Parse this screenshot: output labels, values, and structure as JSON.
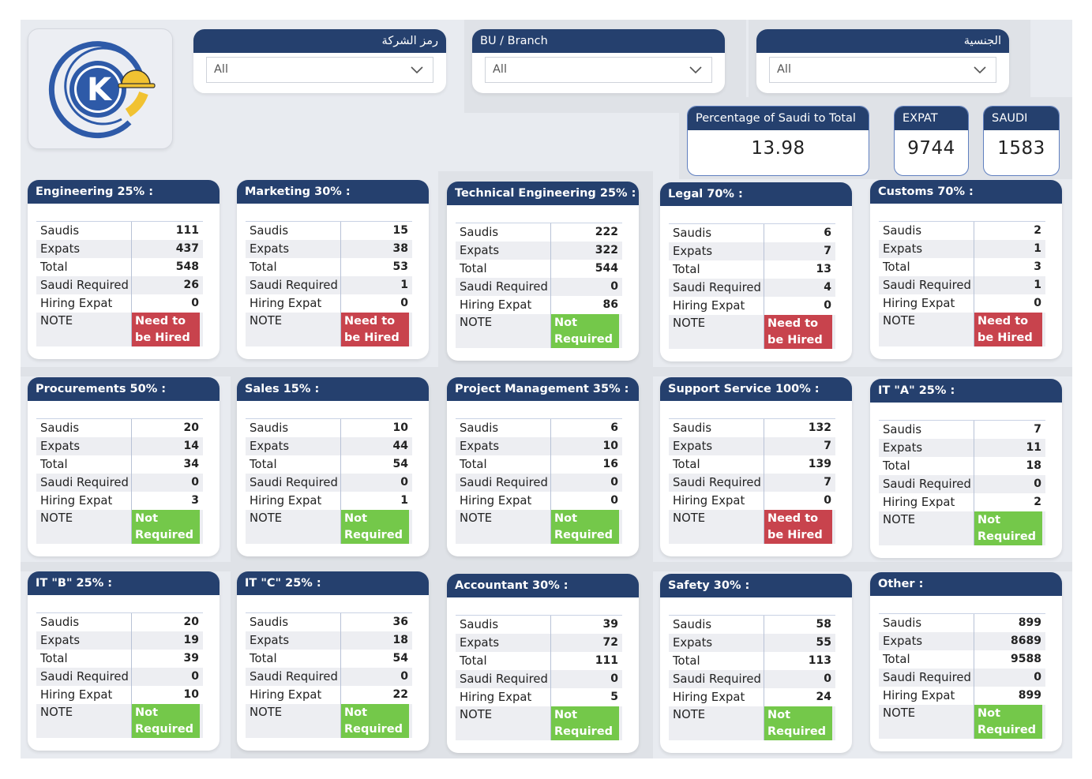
{
  "colors": {
    "header": "#25406e",
    "need_badge": "#c8434d",
    "not_badge": "#74c84a"
  },
  "logo": {
    "letter": "K"
  },
  "filters": [
    {
      "label": "رمز الشركة",
      "value": "All"
    },
    {
      "label": "BU / Branch",
      "value": "All"
    },
    {
      "label": "الجنسية",
      "value": "All"
    }
  ],
  "kpis": [
    {
      "label": "Percentage of Saudi to Total",
      "value": "13.98"
    },
    {
      "label": "EXPAT",
      "value": "9744"
    },
    {
      "label": "SAUDI",
      "value": "1583"
    }
  ],
  "row_labels": [
    "Saudis",
    "Expats",
    "Total",
    "Saudi Required",
    "Hiring Expat",
    "NOTE"
  ],
  "badges": {
    "need": [
      "Need to",
      "be Hired"
    ],
    "not": [
      "Not",
      "Required"
    ]
  },
  "departments": [
    {
      "title": "Engineering 25% :",
      "values": [
        "111",
        "437",
        "548",
        "26",
        "0"
      ],
      "status": "need"
    },
    {
      "title": "Marketing 30% :",
      "values": [
        "15",
        "38",
        "53",
        "1",
        "0"
      ],
      "status": "need"
    },
    {
      "title": "Technical Engineering 25% :",
      "values": [
        "222",
        "322",
        "544",
        "0",
        "86"
      ],
      "status": "not"
    },
    {
      "title": "Legal 70% :",
      "values": [
        "6",
        "7",
        "13",
        "4",
        "0"
      ],
      "status": "need"
    },
    {
      "title": "Customs 70% :",
      "values": [
        "2",
        "1",
        "3",
        "1",
        "0"
      ],
      "status": "need"
    },
    {
      "title": "Procurements 50% :",
      "values": [
        "20",
        "14",
        "34",
        "0",
        "3"
      ],
      "status": "not"
    },
    {
      "title": "Sales 15% :",
      "values": [
        "10",
        "44",
        "54",
        "0",
        "1"
      ],
      "status": "not"
    },
    {
      "title": "Project Management 35% :",
      "values": [
        "6",
        "10",
        "16",
        "0",
        "0"
      ],
      "status": "not"
    },
    {
      "title": "Support Service 100% :",
      "values": [
        "132",
        "7",
        "139",
        "7",
        "0"
      ],
      "status": "need"
    },
    {
      "title": "IT \"A\" 25% :",
      "values": [
        "7",
        "11",
        "18",
        "0",
        "2"
      ],
      "status": "not"
    },
    {
      "title": "IT \"B\" 25% :",
      "values": [
        "20",
        "19",
        "39",
        "0",
        "10"
      ],
      "status": "not"
    },
    {
      "title": "IT \"C\" 25% :",
      "values": [
        "36",
        "18",
        "54",
        "0",
        "22"
      ],
      "status": "not"
    },
    {
      "title": "Accountant 30% :",
      "values": [
        "39",
        "72",
        "111",
        "0",
        "5"
      ],
      "status": "not"
    },
    {
      "title": "Safety 30% :",
      "values": [
        "58",
        "55",
        "113",
        "0",
        "24"
      ],
      "status": "not"
    },
    {
      "title": "Other :",
      "values": [
        "899",
        "8689",
        "9588",
        "0",
        "899"
      ],
      "status": "not"
    }
  ]
}
